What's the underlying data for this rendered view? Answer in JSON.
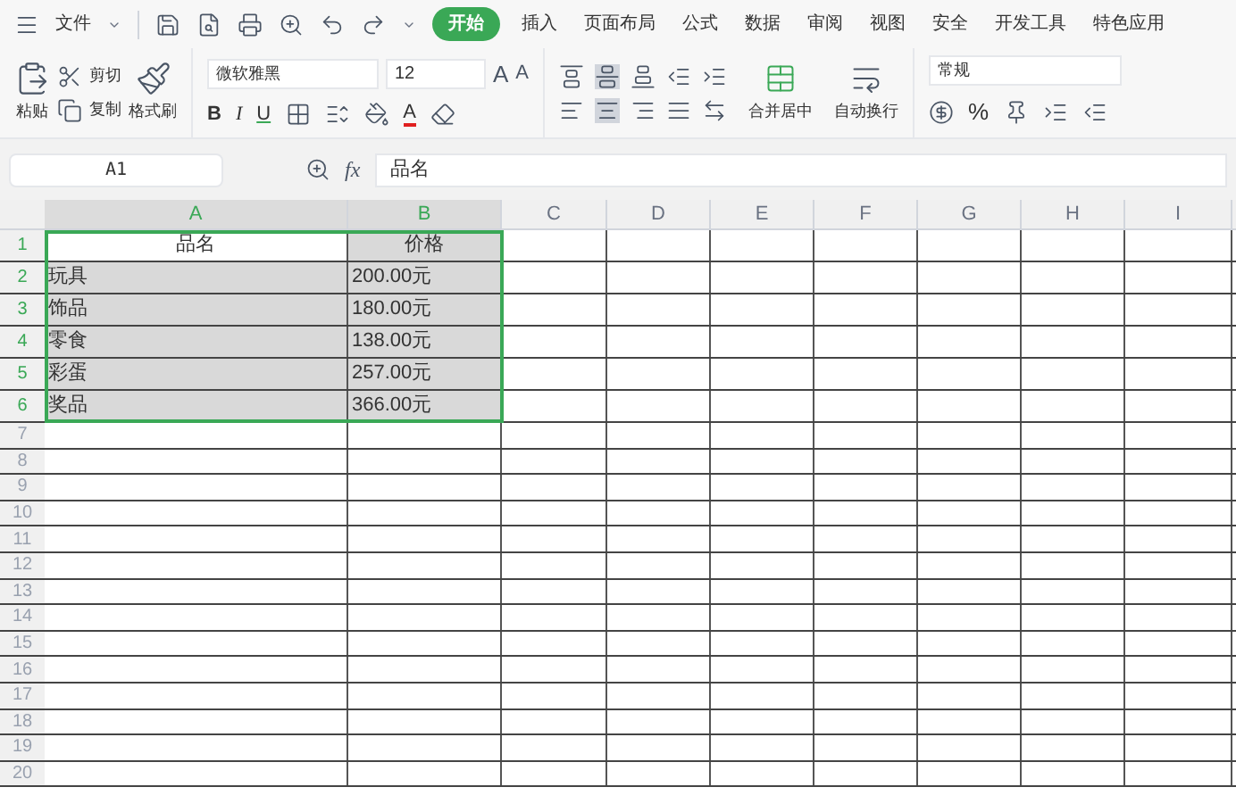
{
  "menu": {
    "file": "文件",
    "tabs": [
      {
        "label": "开始",
        "selected": true
      },
      {
        "label": "插入",
        "selected": false
      },
      {
        "label": "页面布局",
        "selected": false
      },
      {
        "label": "公式",
        "selected": false
      },
      {
        "label": "数据",
        "selected": false
      },
      {
        "label": "审阅",
        "selected": false
      },
      {
        "label": "视图",
        "selected": false
      },
      {
        "label": "安全",
        "selected": false
      },
      {
        "label": "开发工具",
        "selected": false
      },
      {
        "label": "特色应用",
        "selected": false
      }
    ]
  },
  "ribbon": {
    "paste": "粘贴",
    "cut": "剪切",
    "copy": "复制",
    "format_painter": "格式刷",
    "font_name": "微软雅黑",
    "font_size": "12",
    "grow_font": "A",
    "shrink_font": "A",
    "bold": "B",
    "italic": "I",
    "underline": "U",
    "font_color": "A",
    "merge": "合并居中",
    "wrap": "自动换行",
    "number_format": "常规",
    "percent": "%"
  },
  "formula_bar": {
    "name_box": "A1",
    "fx": "fx",
    "value": "品名"
  },
  "grid": {
    "columns": [
      {
        "label": "A",
        "selected": true
      },
      {
        "label": "B",
        "selected": true
      },
      {
        "label": "C",
        "selected": false
      },
      {
        "label": "D",
        "selected": false
      },
      {
        "label": "E",
        "selected": false
      },
      {
        "label": "F",
        "selected": false
      },
      {
        "label": "G",
        "selected": false
      },
      {
        "label": "H",
        "selected": false
      },
      {
        "label": "I",
        "selected": false
      }
    ],
    "rows": [
      {
        "number": "1",
        "selected": true,
        "kind": "header",
        "cells": [
          {
            "text": "品名",
            "active": true
          },
          {
            "text": "价格",
            "active": false
          }
        ]
      },
      {
        "number": "2",
        "selected": true,
        "kind": "data",
        "cells": [
          {
            "text": "玩具",
            "active": false
          },
          {
            "text": "200.00元",
            "active": false
          }
        ]
      },
      {
        "number": "3",
        "selected": true,
        "kind": "data",
        "cells": [
          {
            "text": "饰品",
            "active": false
          },
          {
            "text": "180.00元",
            "active": false
          }
        ]
      },
      {
        "number": "4",
        "selected": true,
        "kind": "data",
        "cells": [
          {
            "text": "零食",
            "active": false
          },
          {
            "text": "138.00元",
            "active": false
          }
        ]
      },
      {
        "number": "5",
        "selected": true,
        "kind": "data",
        "cells": [
          {
            "text": "彩蛋",
            "active": false
          },
          {
            "text": "257.00元",
            "active": false
          }
        ]
      },
      {
        "number": "6",
        "selected": true,
        "kind": "data",
        "cells": [
          {
            "text": "奖品",
            "active": false
          },
          {
            "text": "366.00元",
            "active": false
          }
        ]
      },
      {
        "number": "7",
        "selected": false
      },
      {
        "number": "8",
        "selected": false
      },
      {
        "number": "9",
        "selected": false
      },
      {
        "number": "10",
        "selected": false
      },
      {
        "number": "11",
        "selected": false
      },
      {
        "number": "12",
        "selected": false
      },
      {
        "number": "13",
        "selected": false
      },
      {
        "number": "14",
        "selected": false
      },
      {
        "number": "15",
        "selected": false
      },
      {
        "number": "16",
        "selected": false
      },
      {
        "number": "17",
        "selected": false
      },
      {
        "number": "18",
        "selected": false
      },
      {
        "number": "19",
        "selected": false
      },
      {
        "number": "20",
        "selected": false
      }
    ]
  }
}
